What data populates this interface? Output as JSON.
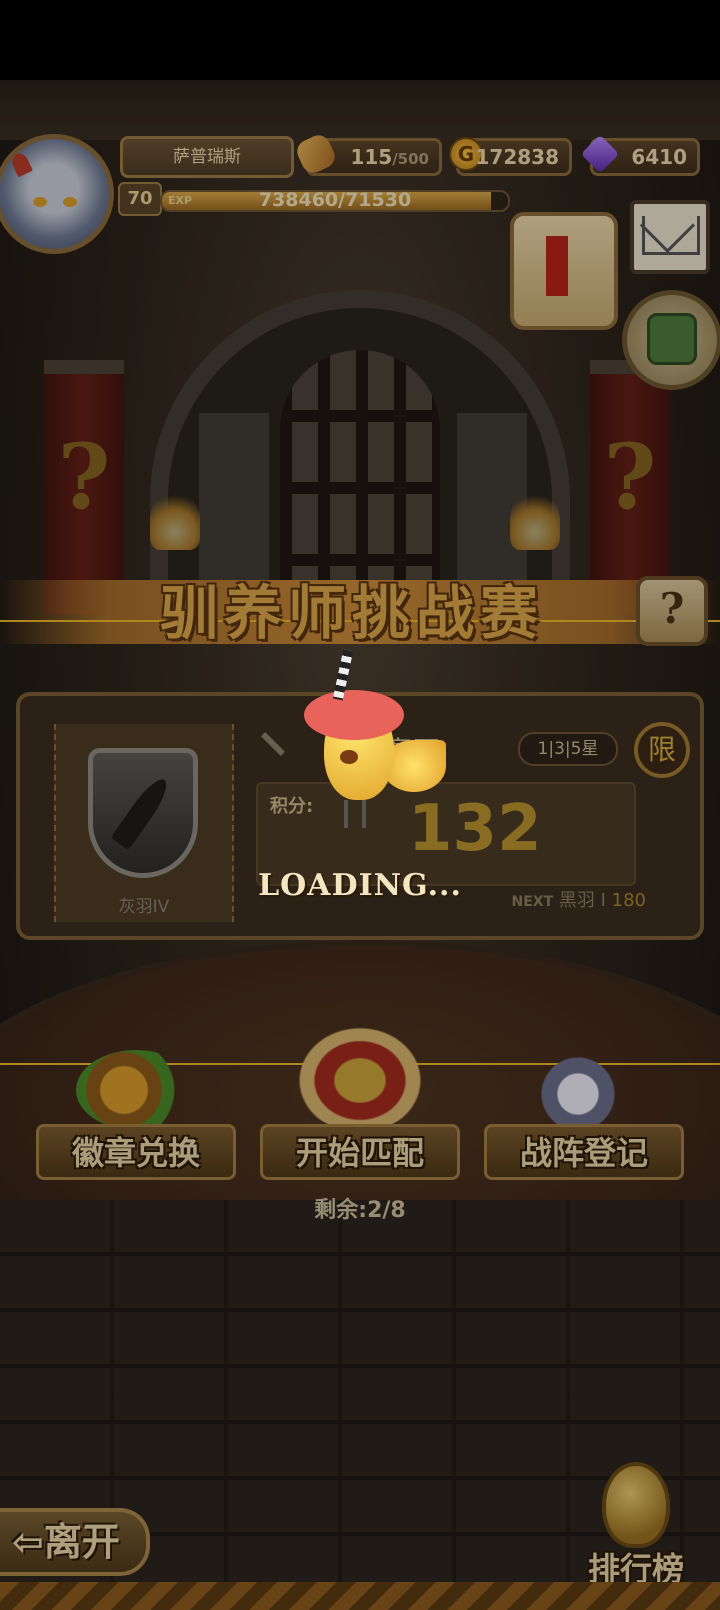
{
  "player": {
    "name": "萨普瑞斯",
    "level": "70",
    "exp_tag": "EXP",
    "exp_text": "738460/71530",
    "exp_progress": 0.95
  },
  "resources": {
    "stamina_current": "115",
    "stamina_max": "/500",
    "gold": "172838",
    "gems": "6410"
  },
  "title": "驯养师挑战赛",
  "help_label": "?",
  "rank_panel": {
    "rank_name": "灰羽IV",
    "zone_name": "新赛区",
    "star_filter": "1|3|5星",
    "limit_label": "限",
    "score_label": "积分:",
    "score_value": "132",
    "next_prefix": "NEXT",
    "next_rank": "黑羽 I",
    "next_points": "180"
  },
  "actions": {
    "badge_exchange": "徽章兑换",
    "start_match": "开始匹配",
    "team_register": "战阵登记",
    "remaining": "剩余:2/8"
  },
  "bottom": {
    "leave_label": "⇦离开",
    "leaderboard_label": "排行榜"
  },
  "loading_text": "LOADING..."
}
